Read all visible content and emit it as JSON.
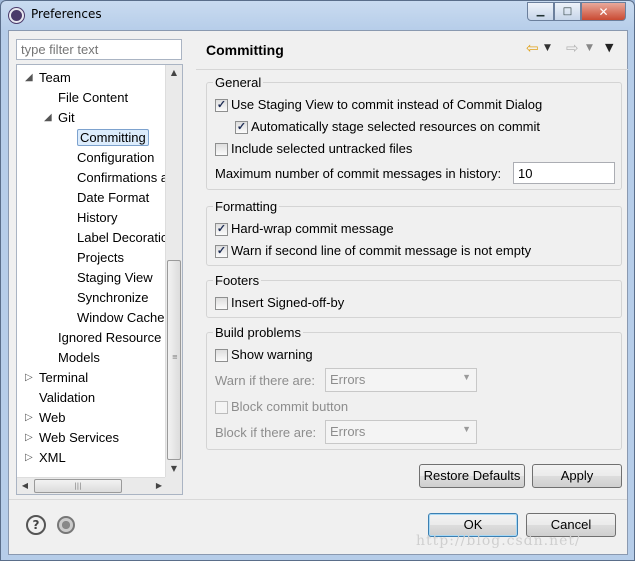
{
  "window": {
    "title": "Preferences"
  },
  "filter": {
    "placeholder": "type filter text"
  },
  "tree": [
    {
      "label": "Team",
      "level": 0,
      "arrow": "expanded"
    },
    {
      "label": "File Content",
      "level": 1,
      "arrow": "none"
    },
    {
      "label": "Git",
      "level": 1,
      "arrow": "expanded"
    },
    {
      "label": "Committing",
      "level": 2,
      "arrow": "none",
      "selected": true
    },
    {
      "label": "Configuration",
      "level": 2,
      "arrow": "none"
    },
    {
      "label": "Confirmations a",
      "level": 2,
      "arrow": "none"
    },
    {
      "label": "Date Format",
      "level": 2,
      "arrow": "none"
    },
    {
      "label": "History",
      "level": 2,
      "arrow": "none"
    },
    {
      "label": "Label Decoratio",
      "level": 2,
      "arrow": "none"
    },
    {
      "label": "Projects",
      "level": 2,
      "arrow": "none"
    },
    {
      "label": "Staging View",
      "level": 2,
      "arrow": "none"
    },
    {
      "label": "Synchronize",
      "level": 2,
      "arrow": "none"
    },
    {
      "label": "Window Cache",
      "level": 2,
      "arrow": "none"
    },
    {
      "label": "Ignored Resource",
      "level": 1,
      "arrow": "none"
    },
    {
      "label": "Models",
      "level": 1,
      "arrow": "none"
    },
    {
      "label": "Terminal",
      "level": 0,
      "arrow": "collapsed"
    },
    {
      "label": "Validation",
      "level": 0,
      "arrow": "none"
    },
    {
      "label": "Web",
      "level": 0,
      "arrow": "collapsed"
    },
    {
      "label": "Web Services",
      "level": 0,
      "arrow": "collapsed"
    },
    {
      "label": "XML",
      "level": 0,
      "arrow": "collapsed"
    }
  ],
  "page": {
    "title": "Committing",
    "general": {
      "title": "General",
      "use_staging_view": {
        "label": "Use Staging View to commit instead of Commit Dialog",
        "checked": true
      },
      "auto_stage": {
        "label": "Automatically stage selected resources on commit",
        "checked": true
      },
      "include_untracked": {
        "label": "Include selected untracked files",
        "checked": false
      },
      "max_messages_label": "Maximum number of commit messages in history:",
      "max_messages_value": "10"
    },
    "formatting": {
      "title": "Formatting",
      "hard_wrap": {
        "label": "Hard-wrap commit message",
        "checked": true
      },
      "warn_second_line": {
        "label": "Warn if second line of commit message is not empty",
        "checked": true
      }
    },
    "footers": {
      "title": "Footers",
      "signed_off": {
        "label": "Insert Signed-off-by",
        "checked": false
      }
    },
    "build_problems": {
      "title": "Build problems",
      "show_warning": {
        "label": "Show warning",
        "checked": false
      },
      "warn_if_label": "Warn if there are:",
      "warn_if_value": "Errors",
      "block_commit": {
        "label": "Block commit button",
        "checked": false
      },
      "block_if_label": "Block if there are:",
      "block_if_value": "Errors"
    },
    "restore_defaults": "Restore Defaults",
    "apply": "Apply"
  },
  "footer": {
    "ok": "OK",
    "cancel": "Cancel"
  },
  "watermark": "http://blog.csdn.net/"
}
